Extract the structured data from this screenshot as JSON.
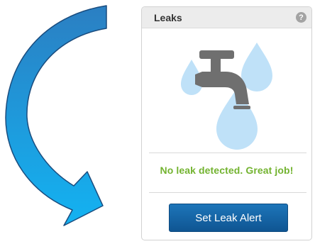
{
  "widget": {
    "title": "Leaks",
    "help_icon": "?",
    "status_message": "No leak detected. Great job!",
    "button_label": "Set Leak Alert"
  },
  "icons": {
    "arrow": "curved-arrow-icon",
    "help": "help-icon",
    "faucet": "faucet-icon",
    "droplets": "water-drop-icon"
  },
  "colors": {
    "status_green": "#73b330",
    "button_blue": "#1565a8",
    "arrow_blue": "#1ca6e6",
    "droplet_blue": "#bfe1f8",
    "faucet_gray": "#6f6f6f"
  }
}
